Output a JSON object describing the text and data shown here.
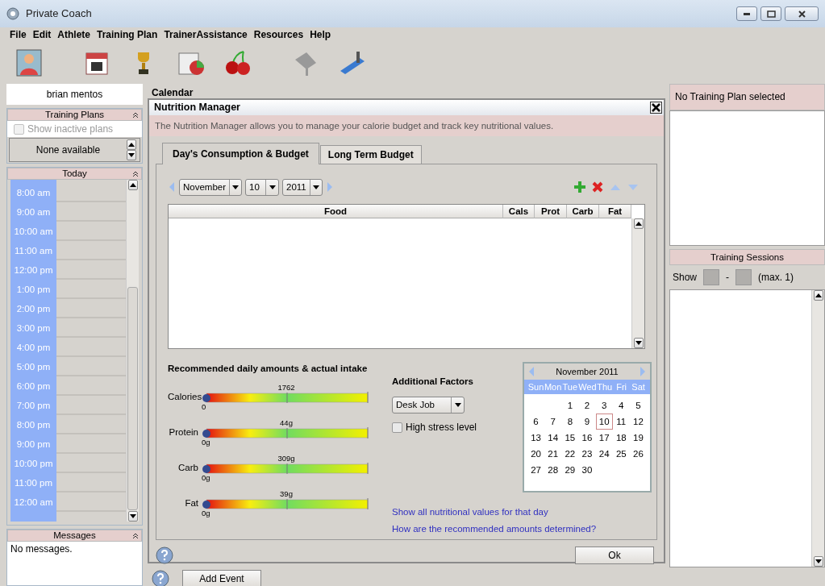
{
  "window": {
    "title": "Private Coach"
  },
  "menu": [
    "File",
    "Edit",
    "Athlete",
    "Training Plan",
    "TrainerAssistance",
    "Resources",
    "Help"
  ],
  "sidebar": {
    "athlete_name": "brian mentos",
    "training_plans": {
      "title": "Training Plans",
      "show_inactive": {
        "label": "Show inactive plans",
        "checked": false,
        "disabled": true
      },
      "value": "None available"
    },
    "today": {
      "title": "Today",
      "times": [
        "8:00 am",
        "9:00 am",
        "10:00 am",
        "11:00 am",
        "12:00 pm",
        "1:00 pm",
        "2:00 pm",
        "3:00 pm",
        "4:00 pm",
        "5:00 pm",
        "6:00 pm",
        "7:00 pm",
        "8:00 pm",
        "9:00 pm",
        "10:00 pm",
        "11:00 pm",
        "12:00 am"
      ]
    },
    "messages": {
      "title": "Messages",
      "text": "No messages."
    }
  },
  "center": {
    "title": "Calendar",
    "add_event": "Add Event"
  },
  "dialog": {
    "title": "Nutrition Manager",
    "description": "The Nutrition Manager allows you to manage your calorie budget and track key nutritional values.",
    "tabs": [
      {
        "label": "Day's Consumption & Budget",
        "selected": true
      },
      {
        "label": "Long Term Budget",
        "selected": false
      }
    ],
    "date": {
      "month": "November",
      "day": "10",
      "year": "2011"
    },
    "table": {
      "columns": [
        "Food",
        "Cals",
        "Prot",
        "Carb",
        "Fat"
      ]
    },
    "intake": {
      "title": "Recommended daily amounts & actual intake",
      "meters": [
        {
          "name": "Calories",
          "recommended": "1762",
          "actual": "0",
          "level": 0
        },
        {
          "name": "Protein",
          "recommended": "44g",
          "actual": "0g",
          "level": 0
        },
        {
          "name": "Carb",
          "recommended": "309g",
          "actual": "0g",
          "level": 0
        },
        {
          "name": "Fat",
          "recommended": "39g",
          "actual": "0g",
          "level": 0
        }
      ]
    },
    "factors": {
      "title": "Additional Factors",
      "activity": "Desk Job",
      "high_stress": {
        "label": "High stress level",
        "checked": false
      }
    },
    "calendar": {
      "title": "November 2011",
      "weekdays": [
        "Sun",
        "Mon",
        "Tue",
        "Wed",
        "Thu",
        "Fri",
        "Sat"
      ],
      "weeks": [
        [
          {
            "kind": "blank"
          },
          {
            "kind": "blank"
          },
          {
            "day": "1",
            "selected": false
          },
          {
            "day": "2",
            "selected": false
          },
          {
            "day": "3",
            "selected": false
          },
          {
            "day": "4",
            "selected": false
          },
          {
            "day": "5",
            "selected": false
          }
        ],
        [
          {
            "day": "6",
            "selected": false
          },
          {
            "day": "7",
            "selected": false
          },
          {
            "day": "8",
            "selected": false
          },
          {
            "day": "9",
            "selected": false
          },
          {
            "day": "10",
            "selected": true
          },
          {
            "day": "11",
            "selected": false
          },
          {
            "day": "12",
            "selected": false
          }
        ],
        [
          {
            "day": "13",
            "selected": false
          },
          {
            "day": "14",
            "selected": false
          },
          {
            "day": "15",
            "selected": false
          },
          {
            "day": "16",
            "selected": false
          },
          {
            "day": "17",
            "selected": false
          },
          {
            "day": "18",
            "selected": false
          },
          {
            "day": "19",
            "selected": false
          }
        ],
        [
          {
            "day": "20",
            "selected": false
          },
          {
            "day": "21",
            "selected": false
          },
          {
            "day": "22",
            "selected": false
          },
          {
            "day": "23",
            "selected": false
          },
          {
            "day": "24",
            "selected": false
          },
          {
            "day": "25",
            "selected": false
          },
          {
            "day": "26",
            "selected": false
          }
        ],
        [
          {
            "day": "27",
            "selected": false
          },
          {
            "day": "28",
            "selected": false
          },
          {
            "day": "29",
            "selected": false
          },
          {
            "day": "30",
            "selected": false
          },
          {
            "kind": "blank"
          },
          {
            "kind": "blank"
          },
          {
            "kind": "blank"
          }
        ]
      ]
    },
    "links": [
      "Show all nutritional values for that day",
      "How are the recommended amounts determined?"
    ],
    "ok": "Ok"
  },
  "right": {
    "plan_title": "No Training Plan selected",
    "sessions_title": "Training Sessions",
    "show_label": "Show",
    "dash": "-",
    "max": "(max. 1)"
  }
}
